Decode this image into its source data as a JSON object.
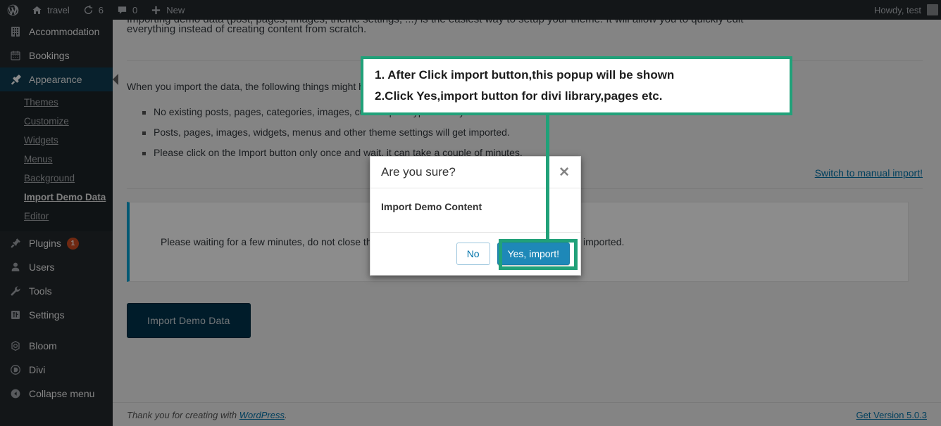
{
  "adminbar": {
    "logo_icon": "wordpress-logo-icon",
    "site_name": "travel",
    "site_icon": "home-icon",
    "updates_icon": "updates-icon",
    "updates_count": "6",
    "comments_icon": "comments-icon",
    "comments_count": "0",
    "new_icon": "plus-icon",
    "new_label": "New",
    "howdy": "Howdy, test"
  },
  "sidebar": {
    "items": [
      {
        "label": "Accommodation",
        "icon": "building-icon",
        "current": false
      },
      {
        "label": "Bookings",
        "icon": "calendar-icon",
        "current": false
      },
      {
        "label": "Appearance",
        "icon": "brush-icon",
        "current": true
      },
      {
        "label": "Plugins",
        "icon": "plugin-icon",
        "current": false,
        "badge": "1"
      },
      {
        "label": "Users",
        "icon": "user-icon",
        "current": false
      },
      {
        "label": "Tools",
        "icon": "wrench-icon",
        "current": false
      },
      {
        "label": "Settings",
        "icon": "settings-icon",
        "current": false
      },
      {
        "label": "Bloom",
        "icon": "bloom-icon",
        "current": false
      },
      {
        "label": "Divi",
        "icon": "divi-icon",
        "current": false
      },
      {
        "label": "Collapse menu",
        "icon": "collapse-arrow-icon",
        "current": false
      }
    ],
    "appearance_submenu": [
      {
        "label": "Themes",
        "current": false
      },
      {
        "label": "Customize",
        "current": false
      },
      {
        "label": "Widgets",
        "current": false
      },
      {
        "label": "Menus",
        "current": false
      },
      {
        "label": "Background",
        "current": false
      },
      {
        "label": "Import Demo Data",
        "current": true
      },
      {
        "label": "Editor",
        "current": false
      }
    ]
  },
  "main": {
    "intro_line1": "Importing demo data (post, pages, images, theme settings, ...) is the easiest way to setup your theme. It will allow you to quickly edit",
    "intro_line2": "everything instead of creating content from scratch.",
    "lead": "When you import the data, the following things might happen:",
    "notes": [
      "No existing posts, pages, categories, images, custom post types or any other data will be deleted or modified.",
      "Posts, pages, images, widgets, menus and other theme settings will get imported.",
      "Please click on the Import button only once and wait, it can take a couple of minutes."
    ],
    "manual_link": "Switch to manual import!",
    "notice_text": "Please waiting for a few minutes, do not close this page, do not refresh this page, until all data is imported.",
    "import_button": "Import Demo Data"
  },
  "footer": {
    "thanks_prefix": "Thank you for creating with ",
    "wordpress_link": "WordPress",
    "thanks_suffix": ".",
    "version_link": "Get Version 5.0.3"
  },
  "modal": {
    "title": "Are you sure?",
    "close_icon": "close-icon",
    "body": "Import Demo Content",
    "no_label": "No",
    "yes_label": "Yes, import!"
  },
  "annotation": {
    "line1": "1. After Click import button,this popup will be shown",
    "line2": "2.Click Yes,import button for divi library,pages etc.",
    "accent_color": "#21a179"
  }
}
